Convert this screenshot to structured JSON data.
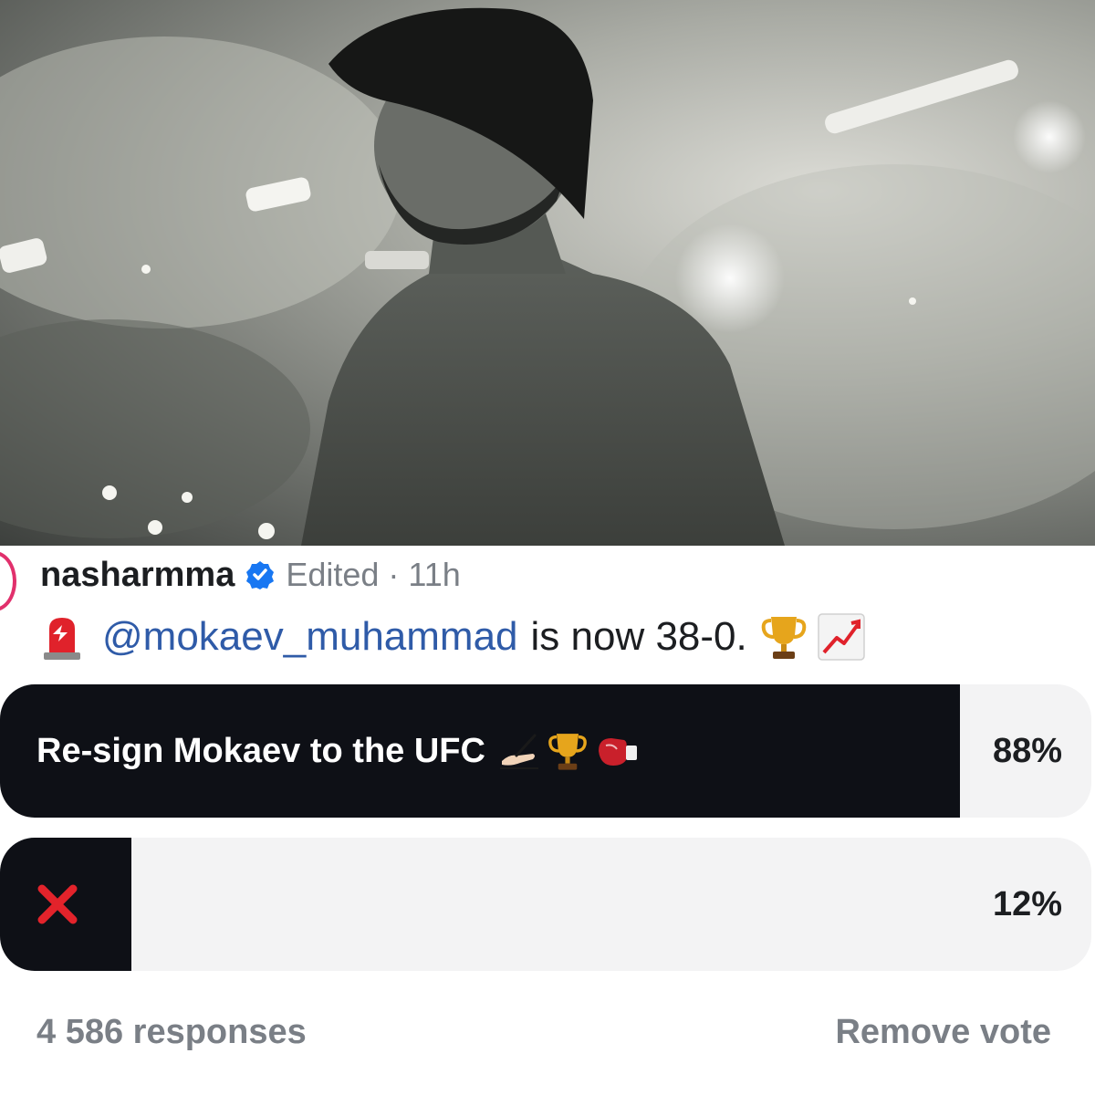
{
  "post": {
    "username": "nasharmma",
    "edited_label": "Edited",
    "separator": "·",
    "time": "11h",
    "caption": {
      "mention": "@mokaev_muhammad",
      "text": "is now 38-0.",
      "leading_icon": "police-light-icon",
      "trailing_icons": [
        "trophy-icon",
        "chart-increasing-icon"
      ]
    }
  },
  "poll": {
    "options": [
      {
        "label": "Re-sign Mokaev to the UFC",
        "percent_label": "88%",
        "percent": 88,
        "icons": [
          "writing-hand-icon",
          "trophy-icon",
          "boxing-glove-icon"
        ]
      },
      {
        "label": "",
        "percent_label": "12%",
        "percent": 12,
        "icons": [
          "cross-mark-icon"
        ]
      }
    ],
    "responses": "4 586 responses",
    "remove_vote": "Remove vote"
  },
  "colors": {
    "accent_link": "#2f5ba8",
    "poll_fill": "#0e1016",
    "poll_track": "#f3f3f4",
    "verified": "#1877f2",
    "muted": "#7a7f86"
  }
}
